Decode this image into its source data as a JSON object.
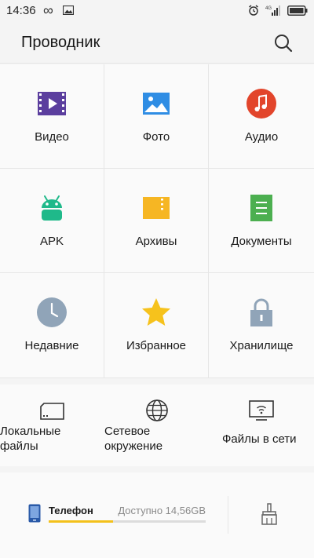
{
  "status_bar": {
    "time": "14:36"
  },
  "app_bar": {
    "title": "Проводник"
  },
  "categories": [
    {
      "label": "Видео",
      "icon": "video-icon",
      "color": "#5b3e9e"
    },
    {
      "label": "Фото",
      "icon": "photo-icon",
      "color": "#2f8de4"
    },
    {
      "label": "Аудио",
      "icon": "audio-icon",
      "color": "#e2452b"
    },
    {
      "label": "APK",
      "icon": "android-icon",
      "color": "#1fb98a"
    },
    {
      "label": "Архивы",
      "icon": "archive-icon",
      "color": "#f6b623"
    },
    {
      "label": "Документы",
      "icon": "document-icon",
      "color": "#4caf50"
    },
    {
      "label": "Недавние",
      "icon": "clock-icon",
      "color": "#90a4b8"
    },
    {
      "label": "Избранное",
      "icon": "star-icon",
      "color": "#f6c21c"
    },
    {
      "label": "Хранилище",
      "icon": "lock-icon",
      "color": "#90a4b8"
    }
  ],
  "network": [
    {
      "label": "Локальные файлы",
      "icon": "local-files-icon"
    },
    {
      "label": "Сетевое окружение",
      "icon": "globe-icon"
    },
    {
      "label": "Файлы в сети",
      "icon": "wifi-files-icon"
    }
  ],
  "storage": {
    "name": "Телефон",
    "free_text": "Доступно 14,56GB",
    "used_fraction": 0.41,
    "accent": "#f3c11b"
  }
}
